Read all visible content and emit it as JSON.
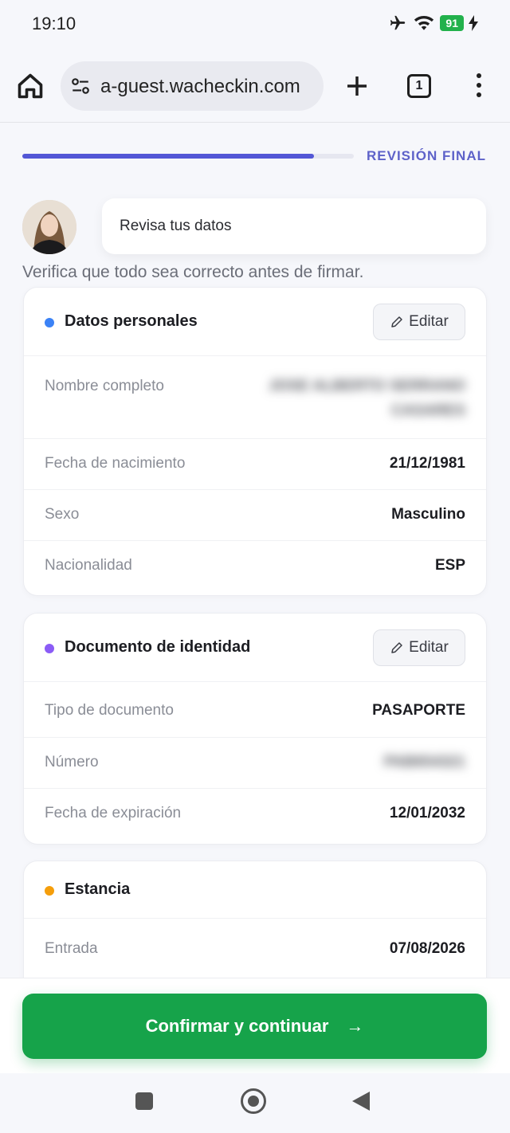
{
  "status_bar": {
    "time": "19:10",
    "battery": "91"
  },
  "browser": {
    "url": "a-guest.wacheckin.com",
    "tab_count": "1"
  },
  "progress": {
    "label": "REVISIÓN FINAL",
    "fraction": 0.88
  },
  "intro": {
    "bubble_text": "Revisa tus datos",
    "subtitle": "Verifica que todo sea correcto antes de firmar."
  },
  "cards": {
    "personal": {
      "title": "Datos personales",
      "dot_color": "#3b82f6",
      "edit_label": "Editar",
      "rows": [
        {
          "label": "Nombre completo",
          "value_line1": "JOSE ALBERTO SERRANO",
          "value_line2": "CASARES"
        },
        {
          "label": "Fecha de nacimiento",
          "value": "21/12/1981"
        },
        {
          "label": "Sexo",
          "value": "Masculino"
        },
        {
          "label": "Nacionalidad",
          "value": "ESP"
        }
      ]
    },
    "document": {
      "title": "Documento de identidad",
      "dot_color": "#8b5cf6",
      "edit_label": "Editar",
      "rows": [
        {
          "label": "Tipo de documento",
          "value": "PASAPORTE"
        },
        {
          "label": "Número",
          "value": "PAB654321"
        },
        {
          "label": "Fecha de expiración",
          "value": "12/01/2032"
        }
      ]
    },
    "stay": {
      "title": "Estancia",
      "dot_color": "#f59e0b",
      "rows": [
        {
          "label": "Entrada",
          "value": "07/08/2026"
        }
      ]
    }
  },
  "footer": {
    "cta_label": "Confirmar y continuar",
    "arrow": "→"
  },
  "colors": {
    "accent": "#5357d6",
    "cta": "#16a34a"
  }
}
